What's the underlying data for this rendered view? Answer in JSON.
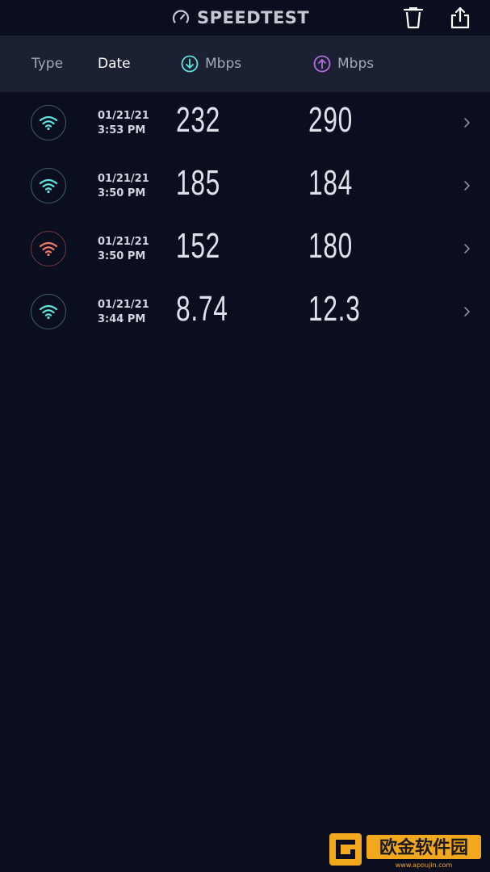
{
  "app": {
    "title": "SPEEDTEST"
  },
  "header": {
    "type_label": "Type",
    "date_label": "Date",
    "download_unit": "Mbps",
    "upload_unit": "Mbps"
  },
  "colors": {
    "download_accent": "#5fe3dc",
    "upload_accent": "#b06ddb",
    "wifi_good": "#5fe3dc",
    "wifi_poor": "#f07a6b"
  },
  "results": [
    {
      "date": "01/21/21",
      "time": "3:53 PM",
      "download": "232",
      "upload": "290",
      "signal": "good"
    },
    {
      "date": "01/21/21",
      "time": "3:50 PM",
      "download": "185",
      "upload": "184",
      "signal": "good"
    },
    {
      "date": "01/21/21",
      "time": "3:50 PM",
      "download": "152",
      "upload": "180",
      "signal": "poor"
    },
    {
      "date": "01/21/21",
      "time": "3:44 PM",
      "download": "8.74",
      "upload": "12.3",
      "signal": "good"
    }
  ],
  "watermark": {
    "text": "欧金软件园",
    "url": "www.apoujin.com"
  }
}
